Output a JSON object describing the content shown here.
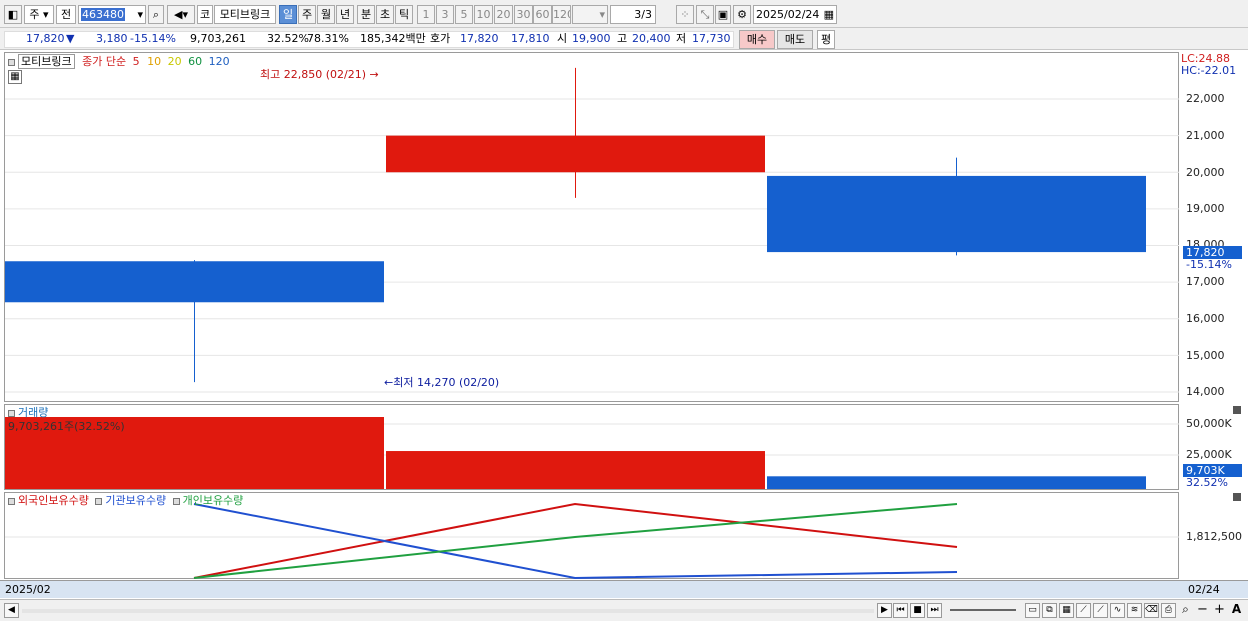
{
  "toolbar": {
    "market": "주",
    "period_prev": "전",
    "code": "463480",
    "exchange": "코",
    "stock_name": "모티브링크",
    "periods": [
      "일",
      "주",
      "월",
      "년",
      "분",
      "초",
      "틱"
    ],
    "active_period": "일",
    "intervals": [
      "1",
      "3",
      "5",
      "10",
      "20",
      "30",
      "60",
      "120"
    ],
    "page": "3/3",
    "date": "2025/02/24"
  },
  "quote": {
    "price": "17,820",
    "arrow": "▼",
    "change": "3,180",
    "change_pct": "-15.14%",
    "volume": "9,703,261",
    "vol_ratio": "32.52%",
    "turnover": "78.31%",
    "trade_value": "185,342백만",
    "ask_label": "호가",
    "ask": "17,820",
    "bid": "17,810",
    "open_label": "시",
    "open": "19,900",
    "high_label": "고",
    "high": "20,400",
    "low_label": "저",
    "low": "17,730",
    "buy_button": "매수",
    "sell_button": "매도",
    "avg_button": "평"
  },
  "price_panel": {
    "name": "모티브링크",
    "ma_label": "종가 단순",
    "ma_periods": [
      {
        "label": "5",
        "color": "#d02020"
      },
      {
        "label": "10",
        "color": "#e0a000"
      },
      {
        "label": "20",
        "color": "#c8c800"
      },
      {
        "label": "60",
        "color": "#109040"
      },
      {
        "label": "120",
        "color": "#2060c0"
      }
    ],
    "high_note": "최고 22,850 (02/21)",
    "low_note": "최저 14,270 (02/20)",
    "lc": "LC:24.88",
    "hc": "HC:-22.01",
    "y_ticks": [
      "22,000",
      "21,000",
      "20,000",
      "19,000",
      "18,000",
      "17,000",
      "16,000",
      "15,000",
      "14,000"
    ],
    "current_price": "17,820",
    "current_pct": "-15.14%"
  },
  "volume_panel": {
    "title": "거래량",
    "detail": "9,703,261주(32.52%)",
    "y_ticks": [
      "50,000K",
      "25,000K"
    ],
    "current": "9,703K",
    "current_pct": "32.52%"
  },
  "holding_panel": {
    "series": [
      {
        "name": "외국인보유수량",
        "color": "#d01010"
      },
      {
        "name": "기관보유수량",
        "color": "#2050d0"
      },
      {
        "name": "개인보유수량",
        "color": "#20a040"
      }
    ],
    "y_tick": "1,812,500"
  },
  "x_axis": {
    "left": "2025/02",
    "right": "02/24"
  },
  "chart_data": {
    "type": "candlestick",
    "dates": [
      "02/20",
      "02/21",
      "02/24"
    ],
    "ohlc": [
      {
        "date": "02/20",
        "open": 17570,
        "high": 17600,
        "low": 14270,
        "close": 16450
      },
      {
        "date": "02/21",
        "open": 20000,
        "high": 22850,
        "low": 19300,
        "close": 21000
      },
      {
        "date": "02/24",
        "open": 19900,
        "high": 20400,
        "low": 17730,
        "close": 17820
      }
    ],
    "volume": [
      {
        "date": "02/20",
        "value": 55000000,
        "color": "#e0190e"
      },
      {
        "date": "02/21",
        "value": 29000000,
        "color": "#e0190e"
      },
      {
        "date": "02/24",
        "value": 9703261,
        "color": "#1560cf"
      }
    ],
    "price_ylim": [
      14000,
      22850
    ],
    "volume_ylim": [
      0,
      55000000
    ],
    "up_color": "#e0190e",
    "down_color": "#1560cf"
  }
}
